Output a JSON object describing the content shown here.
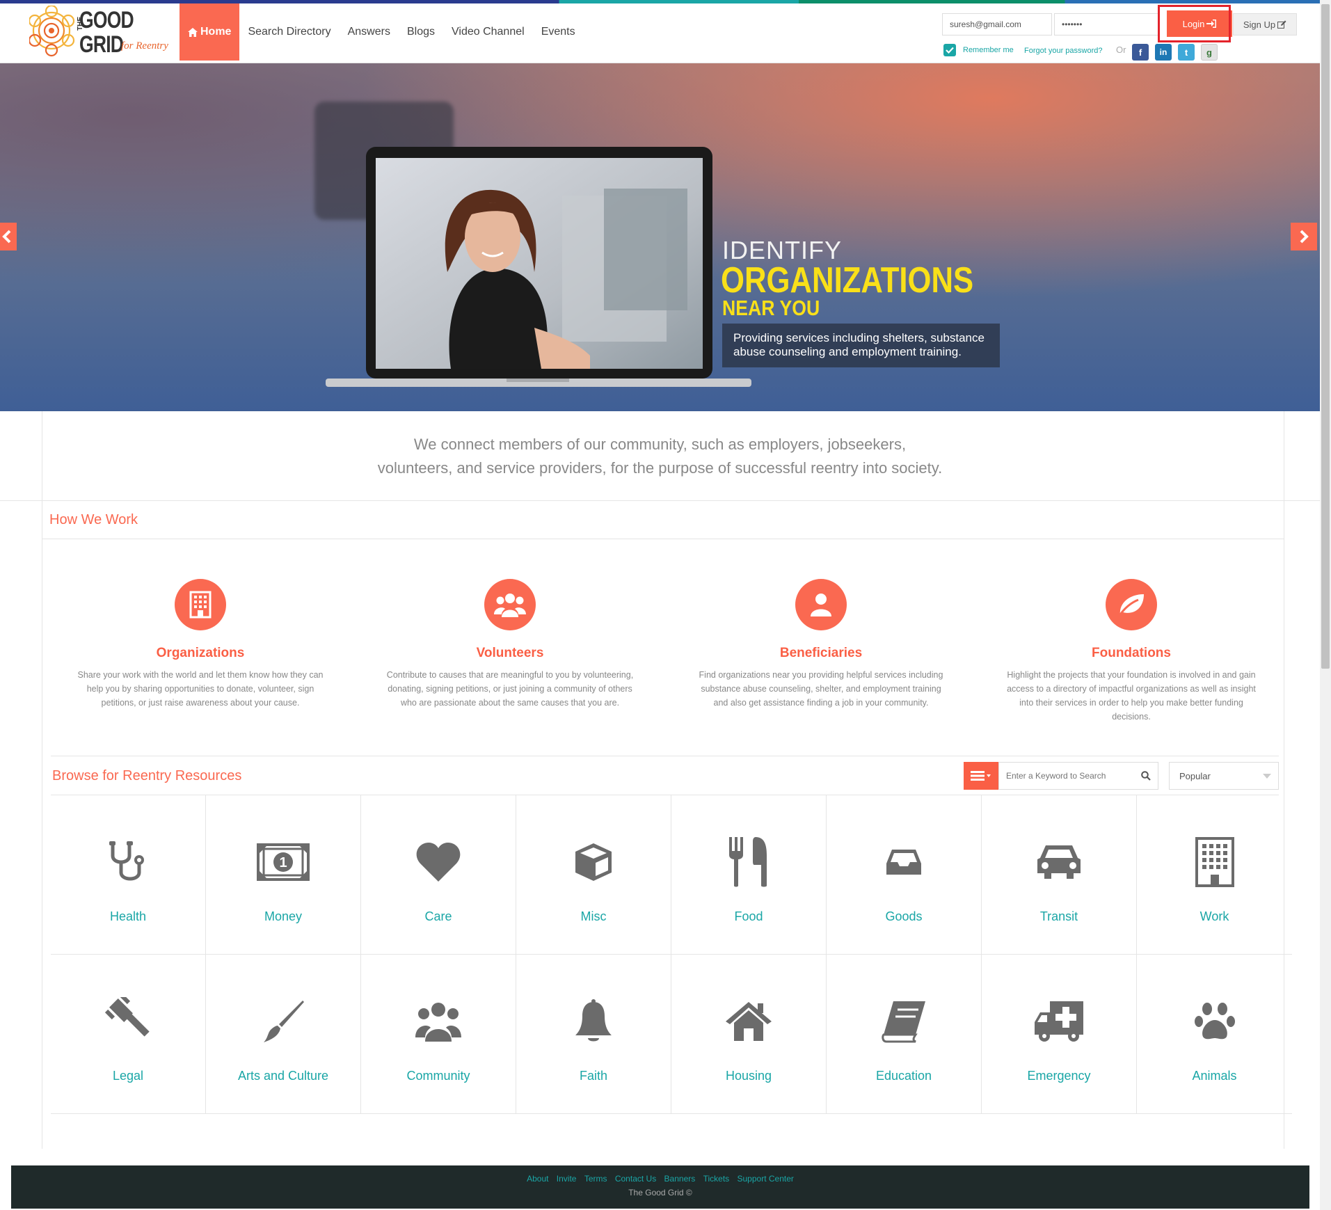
{
  "header": {
    "logo": {
      "line1": "THE",
      "line2": "GOOD",
      "line3": "GRID",
      "tagline": "for Reentry"
    },
    "nav": [
      {
        "label": "Home"
      },
      {
        "label": "Search Directory"
      },
      {
        "label": "Answers"
      },
      {
        "label": "Blogs"
      },
      {
        "label": "Video Channel"
      },
      {
        "label": "Events"
      }
    ],
    "login": {
      "email_value": "suresh@gmail.com",
      "password_value": "•••••••",
      "login_label": "Login",
      "signup_label": "Sign Up",
      "remember_label": "Remember me",
      "forgot_label": "Forgot your password?",
      "or_label": "Or",
      "social": [
        {
          "icon": "facebook-icon",
          "glyph": "f",
          "color": "#3b5998"
        },
        {
          "icon": "linkedin-icon",
          "glyph": "in",
          "color": "#1e78b4"
        },
        {
          "icon": "twitter-icon",
          "glyph": "t",
          "color": "#3fa9d9"
        },
        {
          "icon": "google-icon",
          "glyph": "g",
          "color": "#e3e3e3"
        }
      ]
    }
  },
  "hero": {
    "line1": "IDENTIFY",
    "line2": "ORGANIZATIONS",
    "line3": "NEAR YOU",
    "caption": "Providing services including shelters, substance abuse counseling and employment training."
  },
  "intro": {
    "line1": "We connect members of our community, such as employers, jobseekers,",
    "line2": "volunteers, and service providers, for the purpose of successful reentry into society."
  },
  "how_we_work": {
    "title": "How We Work",
    "features": [
      {
        "title": "Organizations",
        "icon": "building-icon",
        "desc": "Share your work with the world and let them know how they can help you by sharing opportunities to donate, volunteer, sign petitions, or just raise awareness about your cause."
      },
      {
        "title": "Volunteers",
        "icon": "group-icon",
        "desc": "Contribute to causes that are meaningful to you by volunteering, donating, signing petitions, or just joining a community of others who are passionate about the same causes that you are."
      },
      {
        "title": "Beneficiaries",
        "icon": "user-icon",
        "desc": "Find organizations near you providing helpful services including substance abuse counseling, shelter, and employment training and also get assistance finding a job in your community."
      },
      {
        "title": "Foundations",
        "icon": "leaf-icon",
        "desc": "Highlight the projects that your foundation is involved in and gain access to a directory of impactful organizations as well as insight into their services in order to help you make better funding decisions."
      }
    ]
  },
  "browse": {
    "title": "Browse for Reentry Resources",
    "search_placeholder": "Enter a Keyword to Search",
    "sort_selected": "Popular",
    "categories": [
      {
        "label": "Health",
        "icon": "stethoscope-icon"
      },
      {
        "label": "Money",
        "icon": "money-icon"
      },
      {
        "label": "Care",
        "icon": "heart-icon"
      },
      {
        "label": "Misc",
        "icon": "cube-icon"
      },
      {
        "label": "Food",
        "icon": "cutlery-icon"
      },
      {
        "label": "Goods",
        "icon": "inbox-icon"
      },
      {
        "label": "Transit",
        "icon": "car-icon"
      },
      {
        "label": "Work",
        "icon": "building-icon"
      },
      {
        "label": "Legal",
        "icon": "gavel-icon"
      },
      {
        "label": "Arts and Culture",
        "icon": "paintbrush-icon"
      },
      {
        "label": "Community",
        "icon": "group-icon"
      },
      {
        "label": "Faith",
        "icon": "bell-icon"
      },
      {
        "label": "Housing",
        "icon": "home-icon"
      },
      {
        "label": "Education",
        "icon": "book-icon"
      },
      {
        "label": "Emergency",
        "icon": "ambulance-icon"
      },
      {
        "label": "Animals",
        "icon": "paw-icon"
      }
    ]
  },
  "footer": {
    "links": [
      "About",
      "Invite",
      "Terms",
      "Contact Us",
      "Banners",
      "Tickets",
      "Support Center"
    ],
    "copyright": "The Good Grid ©"
  },
  "colors": {
    "accent": "#fa6951",
    "teal": "#1aa6a6",
    "highlight_yellow": "#f9e019",
    "footer_bg": "#1f2a2a"
  }
}
